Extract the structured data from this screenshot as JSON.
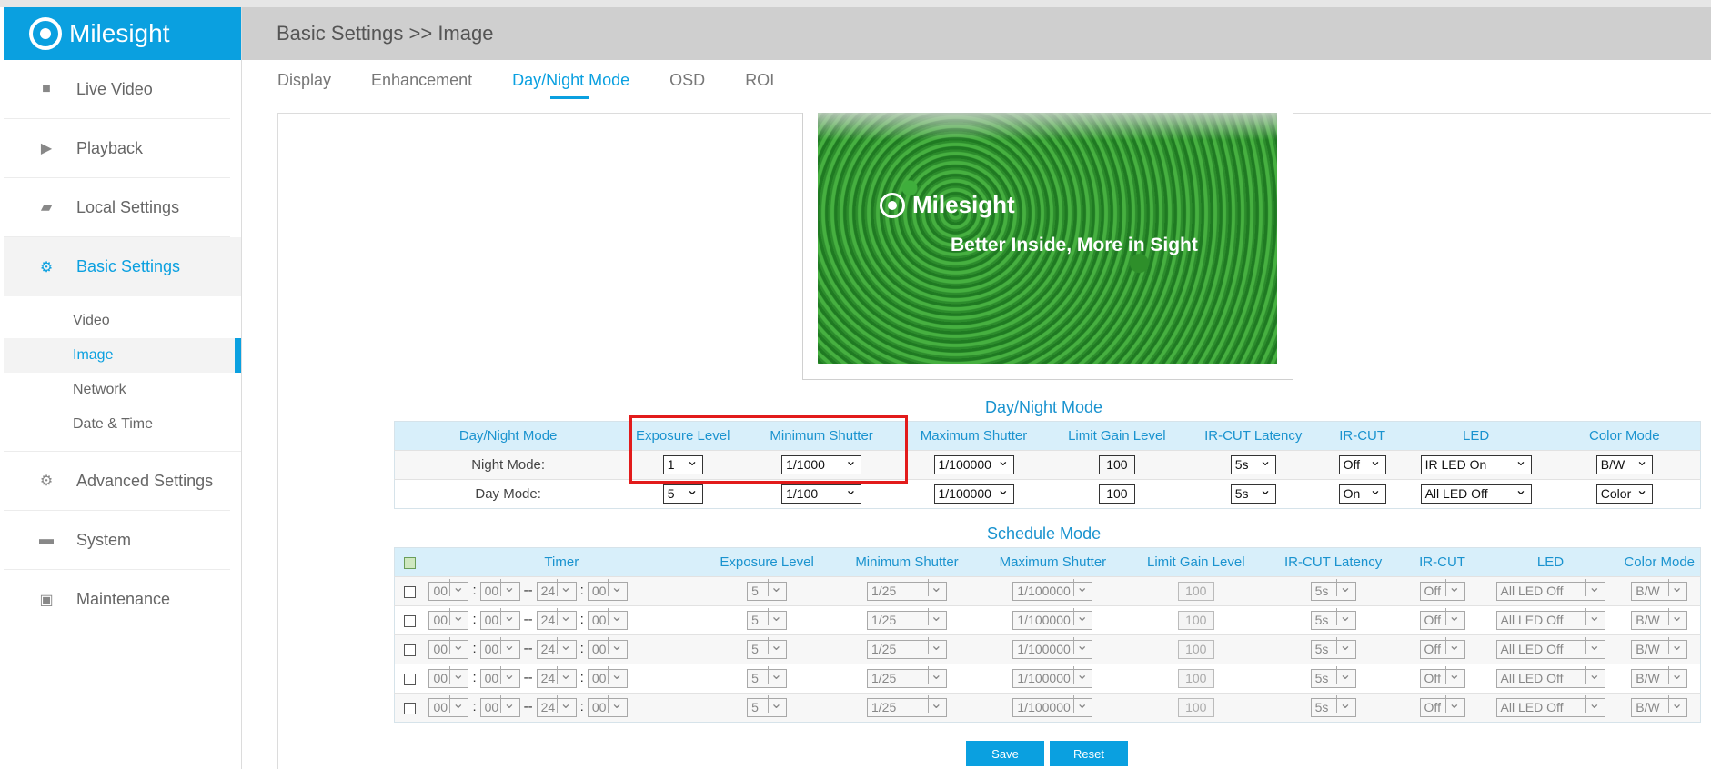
{
  "brand": "Milesight",
  "header": {
    "title": "Basic Settings >> Image"
  },
  "sidebar": {
    "items": [
      {
        "label": "Live Video",
        "icon": "video-camera-icon"
      },
      {
        "label": "Playback",
        "icon": "play-icon"
      },
      {
        "label": "Local Settings",
        "icon": "folder-icon"
      },
      {
        "label": "Basic Settings",
        "icon": "gear-icon"
      },
      {
        "label": "Advanced Settings",
        "icon": "gears-icon"
      },
      {
        "label": "System",
        "icon": "monitor-icon"
      },
      {
        "label": "Maintenance",
        "icon": "toolbox-icon"
      }
    ],
    "subitems": [
      "Video",
      "Image",
      "Network",
      "Date & Time"
    ]
  },
  "tabs": [
    "Display",
    "Enhancement",
    "Day/Night Mode",
    "OSD",
    "ROI"
  ],
  "preview": {
    "brand": "Milesight",
    "slogan": "Better Inside, More in Sight"
  },
  "daynight": {
    "title": "Day/Night Mode",
    "headers": [
      "Day/Night Mode",
      "Exposure Level",
      "Minimum Shutter",
      "Maximum Shutter",
      "Limit Gain Level",
      "IR-CUT Latency",
      "IR-CUT",
      "LED",
      "Color Mode"
    ],
    "night": {
      "label": "Night Mode:",
      "exposure": "1",
      "min_shutter": "1/1000",
      "max_shutter": "1/100000",
      "gain": "100",
      "latency": "5s",
      "ircut": "Off",
      "led": "IR LED On",
      "color": "B/W"
    },
    "day": {
      "label": "Day Mode:",
      "exposure": "5",
      "min_shutter": "1/100",
      "max_shutter": "1/100000",
      "gain": "100",
      "latency": "5s",
      "ircut": "On",
      "led": "All LED Off",
      "color": "Color"
    }
  },
  "schedule": {
    "title": "Schedule Mode",
    "headers": [
      "Timer",
      "Exposure Level",
      "Minimum Shutter",
      "Maximum Shutter",
      "Limit Gain Level",
      "IR-CUT Latency",
      "IR-CUT",
      "LED",
      "Color Mode"
    ],
    "row": {
      "h1": "00",
      "m1": "00",
      "dash": "--",
      "h2": "24",
      "m2": "00",
      "exposure": "5",
      "min_shutter": "1/25",
      "max_shutter": "1/100000",
      "gain": "100",
      "latency": "5s",
      "ircut": "Off",
      "led": "All LED Off",
      "color": "B/W"
    }
  },
  "buttons": {
    "save": "Save",
    "reset": "Reset"
  }
}
